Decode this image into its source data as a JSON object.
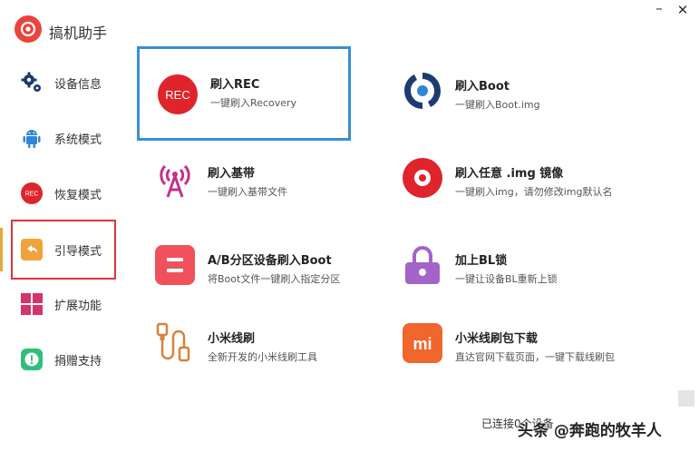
{
  "app": {
    "title": "搞机助手"
  },
  "window": {
    "minimize": "–",
    "close": "✕"
  },
  "sidebar": {
    "items": [
      {
        "label": "设备信息",
        "icon": "gears-icon"
      },
      {
        "label": "系统模式",
        "icon": "android-icon"
      },
      {
        "label": "恢复模式",
        "icon": "rec-icon"
      },
      {
        "label": "引导模式",
        "icon": "back-arrow-icon"
      },
      {
        "label": "扩展功能",
        "icon": "grid-icon"
      },
      {
        "label": "捐赠支持",
        "icon": "donate-icon"
      }
    ]
  },
  "cards": [
    {
      "title": "刷入REC",
      "desc": "一键刷入Recovery",
      "icon_text": "REC"
    },
    {
      "title": "刷入Boot",
      "desc": "一键刷入Boot.img"
    },
    {
      "title": "刷入基带",
      "desc": "一键刷入基带文件"
    },
    {
      "title": "刷入任意 .img 镜像",
      "desc": "一键刷入img，请勿修改img默认名"
    },
    {
      "title": "A/B分区设备刷入Boot",
      "desc": "将Boot文件一键刷入指定分区"
    },
    {
      "title": "加上BL锁",
      "desc": "一键让设备BL重新上锁"
    },
    {
      "title": "小米线刷",
      "desc": "全新开发的小米线刷工具"
    },
    {
      "title": "小米线刷包下载",
      "desc": "直达官网下载页面，一键下载线刷包",
      "icon_text": "mi"
    }
  ],
  "status": {
    "text": "已连接0个设备"
  },
  "watermark": "头条 @奔跑的牧羊人",
  "colors": {
    "accent_red": "#e8453c",
    "selection_blue": "#3b8fd1",
    "active_border": "#d9363e",
    "navy": "#1c3b70",
    "pink": "#c2318f",
    "coral": "#f0515d",
    "purple": "#a363c9",
    "orange": "#f0662d",
    "lock_orange": "#d9823a"
  }
}
